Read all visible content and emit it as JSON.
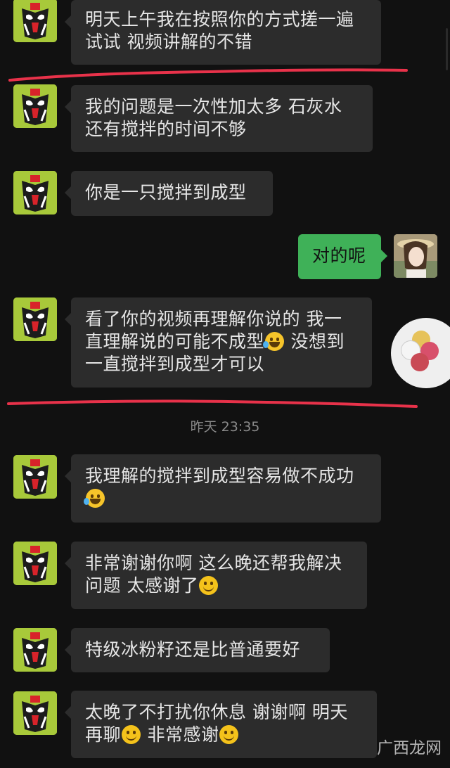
{
  "messages": [
    {
      "side": "left",
      "lines": [
        "明天上午我在按照你的方式搓一遍",
        "试试  视频讲解的不错"
      ]
    },
    {
      "side": "left",
      "lines": [
        "我的问题是一次性加太多 石灰水",
        "还有搅拌的时间不够"
      ]
    },
    {
      "side": "left",
      "lines": [
        "你是一只搅拌到成型"
      ]
    },
    {
      "side": "right",
      "lines": [
        "对的呢"
      ]
    },
    {
      "side": "left",
      "lines": [
        "看了你的视频再理解你说的 我一",
        "直理解说的可能不成型",
        "没想到",
        "一直搅拌到成型才可以"
      ]
    },
    {
      "side": "left",
      "lines": [
        "我理解的搅拌到成型容易做不成功"
      ]
    },
    {
      "side": "left",
      "lines": [
        "非常谢谢你啊 这么晚还帮我解决",
        "问题  太感谢了"
      ]
    },
    {
      "side": "left",
      "lines": [
        "特级冰粉籽还是比普通要好"
      ]
    },
    {
      "side": "left",
      "lines": [
        "太晚了不打扰你休息 谢谢啊  明天",
        "再聊",
        "非常感谢"
      ]
    }
  ],
  "timestamp": "昨天 23:35",
  "watermark": "广西龙网",
  "colors": {
    "background": "#111111",
    "bubble_incoming": "#2c2c2c",
    "bubble_outgoing": "#3fb158",
    "annotation_line": "#e8324a"
  },
  "icons": {
    "laugh_emoji": "rolling-laugh-emoji",
    "smile_emoji": "smile-emoji"
  }
}
